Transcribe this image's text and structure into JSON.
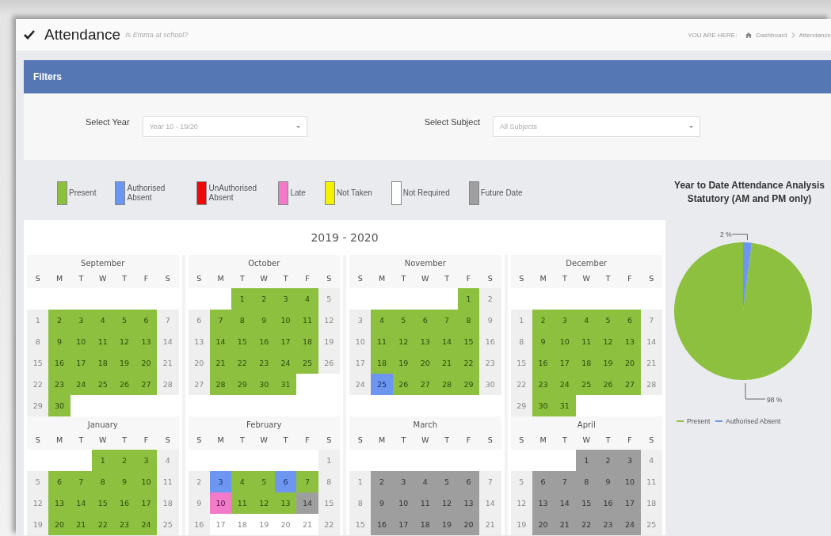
{
  "header": {
    "title": "Attendance",
    "subtitle": "Is Emma at school?",
    "breadcrumb": {
      "prefix": "YOU ARE HERE:",
      "items": [
        "Dashboard",
        "Attendance"
      ]
    }
  },
  "filters": {
    "title": "Filters",
    "fields": [
      {
        "label": "Select Year",
        "value": "Year 10 - 19/20"
      },
      {
        "label": "Select Subject",
        "value": "All Subjects"
      }
    ]
  },
  "legend": [
    {
      "label": "Present",
      "color": "#8dc03f"
    },
    {
      "label": "Authorised Absent",
      "color": "#6d96f0"
    },
    {
      "label": "UnAuthorised Absent",
      "color": "#ee0a0a"
    },
    {
      "label": "Late",
      "color": "#f27bc9"
    },
    {
      "label": "Not Taken",
      "color": "#f5f200"
    },
    {
      "label": "Not Required",
      "color": "#ffffff"
    },
    {
      "label": "Future Date",
      "color": "#9e9e9e"
    }
  ],
  "calendar": {
    "title": "2019 - 2020",
    "months": [
      {
        "name": "September",
        "weekdays": [
          "S",
          "M",
          "T",
          "W",
          "T",
          "F",
          "S"
        ],
        "weeks": [
          [
            {
              "kind": "blank"
            },
            {
              "kind": "blank"
            },
            {
              "kind": "blank"
            },
            {
              "kind": "blank"
            },
            {
              "kind": "blank"
            },
            {
              "kind": "blank"
            },
            {
              "kind": "blank"
            }
          ],
          [
            {
              "day": "1",
              "kind": "weekend"
            },
            {
              "day": "2",
              "kind": "present"
            },
            {
              "day": "3",
              "kind": "present"
            },
            {
              "day": "4",
              "kind": "present"
            },
            {
              "day": "5",
              "kind": "present"
            },
            {
              "day": "6",
              "kind": "present"
            },
            {
              "day": "7",
              "kind": "weekend"
            }
          ],
          [
            {
              "day": "8",
              "kind": "weekend"
            },
            {
              "day": "9",
              "kind": "present"
            },
            {
              "day": "10",
              "kind": "present"
            },
            {
              "day": "11",
              "kind": "present"
            },
            {
              "day": "12",
              "kind": "present"
            },
            {
              "day": "13",
              "kind": "present"
            },
            {
              "day": "14",
              "kind": "weekend"
            }
          ],
          [
            {
              "day": "15",
              "kind": "weekend"
            },
            {
              "day": "16",
              "kind": "present"
            },
            {
              "day": "17",
              "kind": "present"
            },
            {
              "day": "18",
              "kind": "present"
            },
            {
              "day": "19",
              "kind": "present"
            },
            {
              "day": "20",
              "kind": "present"
            },
            {
              "day": "21",
              "kind": "weekend"
            }
          ],
          [
            {
              "day": "22",
              "kind": "weekend"
            },
            {
              "day": "23",
              "kind": "present"
            },
            {
              "day": "24",
              "kind": "present"
            },
            {
              "day": "25",
              "kind": "present"
            },
            {
              "day": "26",
              "kind": "present"
            },
            {
              "day": "27",
              "kind": "present"
            },
            {
              "day": "28",
              "kind": "weekend"
            }
          ],
          [
            {
              "day": "29",
              "kind": "weekend"
            },
            {
              "day": "30",
              "kind": "present"
            },
            {
              "kind": "blank"
            },
            {
              "kind": "blank"
            },
            {
              "kind": "blank"
            },
            {
              "kind": "blank"
            },
            {
              "kind": "blank"
            }
          ]
        ]
      },
      {
        "name": "October",
        "weekdays": [
          "S",
          "M",
          "T",
          "W",
          "T",
          "F",
          "S"
        ],
        "weeks": [
          [
            {
              "kind": "blank"
            },
            {
              "kind": "blank"
            },
            {
              "day": "1",
              "kind": "present"
            },
            {
              "day": "2",
              "kind": "present"
            },
            {
              "day": "3",
              "kind": "present"
            },
            {
              "day": "4",
              "kind": "present"
            },
            {
              "day": "5",
              "kind": "weekend"
            }
          ],
          [
            {
              "day": "6",
              "kind": "weekend"
            },
            {
              "day": "7",
              "kind": "present"
            },
            {
              "day": "8",
              "kind": "present"
            },
            {
              "day": "9",
              "kind": "present"
            },
            {
              "day": "10",
              "kind": "present"
            },
            {
              "day": "11",
              "kind": "present"
            },
            {
              "day": "12",
              "kind": "weekend"
            }
          ],
          [
            {
              "day": "13",
              "kind": "weekend"
            },
            {
              "day": "14",
              "kind": "present"
            },
            {
              "day": "15",
              "kind": "present"
            },
            {
              "day": "16",
              "kind": "present"
            },
            {
              "day": "17",
              "kind": "present"
            },
            {
              "day": "18",
              "kind": "present"
            },
            {
              "day": "19",
              "kind": "weekend"
            }
          ],
          [
            {
              "day": "20",
              "kind": "weekend"
            },
            {
              "day": "21",
              "kind": "present"
            },
            {
              "day": "22",
              "kind": "present"
            },
            {
              "day": "23",
              "kind": "present"
            },
            {
              "day": "24",
              "kind": "present"
            },
            {
              "day": "25",
              "kind": "present"
            },
            {
              "day": "26",
              "kind": "weekend"
            }
          ],
          [
            {
              "day": "27",
              "kind": "weekend"
            },
            {
              "day": "28",
              "kind": "present"
            },
            {
              "day": "29",
              "kind": "present"
            },
            {
              "day": "30",
              "kind": "present"
            },
            {
              "day": "31",
              "kind": "present"
            },
            {
              "kind": "blank"
            },
            {
              "kind": "blank"
            }
          ],
          [
            {
              "kind": "blank"
            },
            {
              "kind": "blank"
            },
            {
              "kind": "blank"
            },
            {
              "kind": "blank"
            },
            {
              "kind": "blank"
            },
            {
              "kind": "blank"
            },
            {
              "kind": "blank"
            }
          ]
        ]
      },
      {
        "name": "November",
        "weekdays": [
          "S",
          "M",
          "T",
          "W",
          "T",
          "F",
          "S"
        ],
        "weeks": [
          [
            {
              "kind": "blank"
            },
            {
              "kind": "blank"
            },
            {
              "kind": "blank"
            },
            {
              "kind": "blank"
            },
            {
              "kind": "blank"
            },
            {
              "day": "1",
              "kind": "present"
            },
            {
              "day": "2",
              "kind": "weekend"
            }
          ],
          [
            {
              "day": "3",
              "kind": "weekend"
            },
            {
              "day": "4",
              "kind": "present"
            },
            {
              "day": "5",
              "kind": "present"
            },
            {
              "day": "6",
              "kind": "present"
            },
            {
              "day": "7",
              "kind": "present"
            },
            {
              "day": "8",
              "kind": "present"
            },
            {
              "day": "9",
              "kind": "weekend"
            }
          ],
          [
            {
              "day": "10",
              "kind": "weekend"
            },
            {
              "day": "11",
              "kind": "present"
            },
            {
              "day": "12",
              "kind": "present"
            },
            {
              "day": "13",
              "kind": "present"
            },
            {
              "day": "14",
              "kind": "present"
            },
            {
              "day": "15",
              "kind": "present"
            },
            {
              "day": "16",
              "kind": "weekend"
            }
          ],
          [
            {
              "day": "17",
              "kind": "weekend"
            },
            {
              "day": "18",
              "kind": "present"
            },
            {
              "day": "19",
              "kind": "present"
            },
            {
              "day": "20",
              "kind": "present"
            },
            {
              "day": "21",
              "kind": "present"
            },
            {
              "day": "22",
              "kind": "present"
            },
            {
              "day": "23",
              "kind": "weekend"
            }
          ],
          [
            {
              "day": "24",
              "kind": "weekend"
            },
            {
              "day": "25",
              "kind": "authorised"
            },
            {
              "day": "26",
              "kind": "present"
            },
            {
              "day": "27",
              "kind": "present"
            },
            {
              "day": "28",
              "kind": "present"
            },
            {
              "day": "29",
              "kind": "present"
            },
            {
              "day": "30",
              "kind": "weekend"
            }
          ],
          [
            {
              "kind": "blank"
            },
            {
              "kind": "blank"
            },
            {
              "kind": "blank"
            },
            {
              "kind": "blank"
            },
            {
              "kind": "blank"
            },
            {
              "kind": "blank"
            },
            {
              "kind": "blank"
            }
          ]
        ]
      },
      {
        "name": "December",
        "weekdays": [
          "S",
          "M",
          "T",
          "W",
          "T",
          "F",
          "S"
        ],
        "weeks": [
          [
            {
              "kind": "blank"
            },
            {
              "kind": "blank"
            },
            {
              "kind": "blank"
            },
            {
              "kind": "blank"
            },
            {
              "kind": "blank"
            },
            {
              "kind": "blank"
            },
            {
              "kind": "blank"
            }
          ],
          [
            {
              "day": "1",
              "kind": "weekend"
            },
            {
              "day": "2",
              "kind": "present"
            },
            {
              "day": "3",
              "kind": "present"
            },
            {
              "day": "4",
              "kind": "present"
            },
            {
              "day": "5",
              "kind": "present"
            },
            {
              "day": "6",
              "kind": "present"
            },
            {
              "day": "7",
              "kind": "weekend"
            }
          ],
          [
            {
              "day": "8",
              "kind": "weekend"
            },
            {
              "day": "9",
              "kind": "present"
            },
            {
              "day": "10",
              "kind": "present"
            },
            {
              "day": "11",
              "kind": "present"
            },
            {
              "day": "12",
              "kind": "present"
            },
            {
              "day": "13",
              "kind": "present"
            },
            {
              "day": "14",
              "kind": "weekend"
            }
          ],
          [
            {
              "day": "15",
              "kind": "weekend"
            },
            {
              "day": "16",
              "kind": "present"
            },
            {
              "day": "17",
              "kind": "present"
            },
            {
              "day": "18",
              "kind": "present"
            },
            {
              "day": "19",
              "kind": "present"
            },
            {
              "day": "20",
              "kind": "present"
            },
            {
              "day": "21",
              "kind": "weekend"
            }
          ],
          [
            {
              "day": "22",
              "kind": "weekend"
            },
            {
              "day": "23",
              "kind": "present"
            },
            {
              "day": "24",
              "kind": "present"
            },
            {
              "day": "25",
              "kind": "present"
            },
            {
              "day": "26",
              "kind": "present"
            },
            {
              "day": "27",
              "kind": "present"
            },
            {
              "day": "28",
              "kind": "weekend"
            }
          ],
          [
            {
              "day": "29",
              "kind": "weekend"
            },
            {
              "day": "30",
              "kind": "present"
            },
            {
              "day": "31",
              "kind": "present"
            },
            {
              "kind": "blank"
            },
            {
              "kind": "blank"
            },
            {
              "kind": "blank"
            },
            {
              "kind": "blank"
            }
          ]
        ]
      },
      {
        "name": "January",
        "weekdays": [
          "S",
          "M",
          "T",
          "W",
          "T",
          "F",
          "S"
        ],
        "weeks": [
          [
            {
              "kind": "blank"
            },
            {
              "kind": "blank"
            },
            {
              "kind": "blank"
            },
            {
              "day": "1",
              "kind": "present"
            },
            {
              "day": "2",
              "kind": "present"
            },
            {
              "day": "3",
              "kind": "present"
            },
            {
              "day": "4",
              "kind": "weekend"
            }
          ],
          [
            {
              "day": "5",
              "kind": "weekend"
            },
            {
              "day": "6",
              "kind": "present"
            },
            {
              "day": "7",
              "kind": "present"
            },
            {
              "day": "8",
              "kind": "present"
            },
            {
              "day": "9",
              "kind": "present"
            },
            {
              "day": "10",
              "kind": "present"
            },
            {
              "day": "11",
              "kind": "weekend"
            }
          ],
          [
            {
              "day": "12",
              "kind": "weekend"
            },
            {
              "day": "13",
              "kind": "present"
            },
            {
              "day": "14",
              "kind": "present"
            },
            {
              "day": "15",
              "kind": "present"
            },
            {
              "day": "16",
              "kind": "present"
            },
            {
              "day": "17",
              "kind": "present"
            },
            {
              "day": "18",
              "kind": "weekend"
            }
          ],
          [
            {
              "day": "19",
              "kind": "weekend"
            },
            {
              "day": "20",
              "kind": "present"
            },
            {
              "day": "21",
              "kind": "present"
            },
            {
              "day": "22",
              "kind": "present"
            },
            {
              "day": "23",
              "kind": "present"
            },
            {
              "day": "24",
              "kind": "present"
            },
            {
              "day": "25",
              "kind": "weekend"
            }
          ]
        ]
      },
      {
        "name": "February",
        "weekdays": [
          "S",
          "M",
          "T",
          "W",
          "T",
          "F",
          "S"
        ],
        "weeks": [
          [
            {
              "kind": "blank"
            },
            {
              "kind": "blank"
            },
            {
              "kind": "blank"
            },
            {
              "kind": "blank"
            },
            {
              "kind": "blank"
            },
            {
              "kind": "blank"
            },
            {
              "day": "1",
              "kind": "weekend"
            }
          ],
          [
            {
              "day": "2",
              "kind": "weekend"
            },
            {
              "day": "3",
              "kind": "authorised"
            },
            {
              "day": "4",
              "kind": "present"
            },
            {
              "day": "5",
              "kind": "present"
            },
            {
              "day": "6",
              "kind": "authorised"
            },
            {
              "day": "7",
              "kind": "present"
            },
            {
              "day": "8",
              "kind": "weekend"
            }
          ],
          [
            {
              "day": "9",
              "kind": "weekend"
            },
            {
              "day": "10",
              "kind": "late"
            },
            {
              "day": "11",
              "kind": "present"
            },
            {
              "day": "12",
              "kind": "present"
            },
            {
              "day": "13",
              "kind": "present"
            },
            {
              "day": "14",
              "kind": "future"
            },
            {
              "day": "15",
              "kind": "weekend"
            }
          ],
          [
            {
              "day": "16",
              "kind": "weekend"
            },
            {
              "day": "17",
              "kind": "none"
            },
            {
              "day": "18",
              "kind": "none"
            },
            {
              "day": "19",
              "kind": "none"
            },
            {
              "day": "20",
              "kind": "none"
            },
            {
              "day": "21",
              "kind": "none"
            },
            {
              "day": "22",
              "kind": "weekend"
            }
          ]
        ]
      },
      {
        "name": "March",
        "weekdays": [
          "S",
          "M",
          "T",
          "W",
          "T",
          "F",
          "S"
        ],
        "weeks": [
          [
            {
              "kind": "blank"
            },
            {
              "kind": "blank"
            },
            {
              "kind": "blank"
            },
            {
              "kind": "blank"
            },
            {
              "kind": "blank"
            },
            {
              "kind": "blank"
            },
            {
              "kind": "blank"
            }
          ],
          [
            {
              "day": "1",
              "kind": "weekend"
            },
            {
              "day": "2",
              "kind": "future"
            },
            {
              "day": "3",
              "kind": "future"
            },
            {
              "day": "4",
              "kind": "future"
            },
            {
              "day": "5",
              "kind": "future"
            },
            {
              "day": "6",
              "kind": "future"
            },
            {
              "day": "7",
              "kind": "weekend"
            }
          ],
          [
            {
              "day": "8",
              "kind": "weekend"
            },
            {
              "day": "9",
              "kind": "future"
            },
            {
              "day": "10",
              "kind": "future"
            },
            {
              "day": "11",
              "kind": "future"
            },
            {
              "day": "12",
              "kind": "future"
            },
            {
              "day": "13",
              "kind": "future"
            },
            {
              "day": "14",
              "kind": "weekend"
            }
          ],
          [
            {
              "day": "15",
              "kind": "weekend"
            },
            {
              "day": "16",
              "kind": "future"
            },
            {
              "day": "17",
              "kind": "future"
            },
            {
              "day": "18",
              "kind": "future"
            },
            {
              "day": "19",
              "kind": "future"
            },
            {
              "day": "20",
              "kind": "future"
            },
            {
              "day": "21",
              "kind": "weekend"
            }
          ]
        ]
      },
      {
        "name": "April",
        "weekdays": [
          "S",
          "M",
          "T",
          "W",
          "T",
          "F",
          "S"
        ],
        "weeks": [
          [
            {
              "kind": "blank"
            },
            {
              "kind": "blank"
            },
            {
              "kind": "blank"
            },
            {
              "day": "1",
              "kind": "future"
            },
            {
              "day": "2",
              "kind": "future"
            },
            {
              "day": "3",
              "kind": "future"
            },
            {
              "day": "4",
              "kind": "weekend"
            }
          ],
          [
            {
              "day": "5",
              "kind": "weekend"
            },
            {
              "day": "6",
              "kind": "future"
            },
            {
              "day": "7",
              "kind": "future"
            },
            {
              "day": "8",
              "kind": "future"
            },
            {
              "day": "9",
              "kind": "future"
            },
            {
              "day": "10",
              "kind": "future"
            },
            {
              "day": "11",
              "kind": "weekend"
            }
          ],
          [
            {
              "day": "12",
              "kind": "weekend"
            },
            {
              "day": "13",
              "kind": "future"
            },
            {
              "day": "14",
              "kind": "future"
            },
            {
              "day": "15",
              "kind": "future"
            },
            {
              "day": "16",
              "kind": "future"
            },
            {
              "day": "17",
              "kind": "future"
            },
            {
              "day": "18",
              "kind": "weekend"
            }
          ],
          [
            {
              "day": "19",
              "kind": "weekend"
            },
            {
              "day": "20",
              "kind": "future"
            },
            {
              "day": "21",
              "kind": "future"
            },
            {
              "day": "22",
              "kind": "future"
            },
            {
              "day": "23",
              "kind": "future"
            },
            {
              "day": "24",
              "kind": "future"
            },
            {
              "day": "25",
              "kind": "weekend"
            }
          ]
        ]
      }
    ]
  },
  "analysis": {
    "chart_data": {
      "type": "pie",
      "title": "Year to Date Attendance Analysis Statutory (AM and PM only)",
      "categories": [
        "Present",
        "Authorised Absent"
      ],
      "values": [
        98,
        2
      ],
      "colors": [
        "#8dc03f",
        "#6d96f0"
      ],
      "value_labels": [
        "98 %",
        "2 %"
      ],
      "legend": "bottom"
    }
  }
}
